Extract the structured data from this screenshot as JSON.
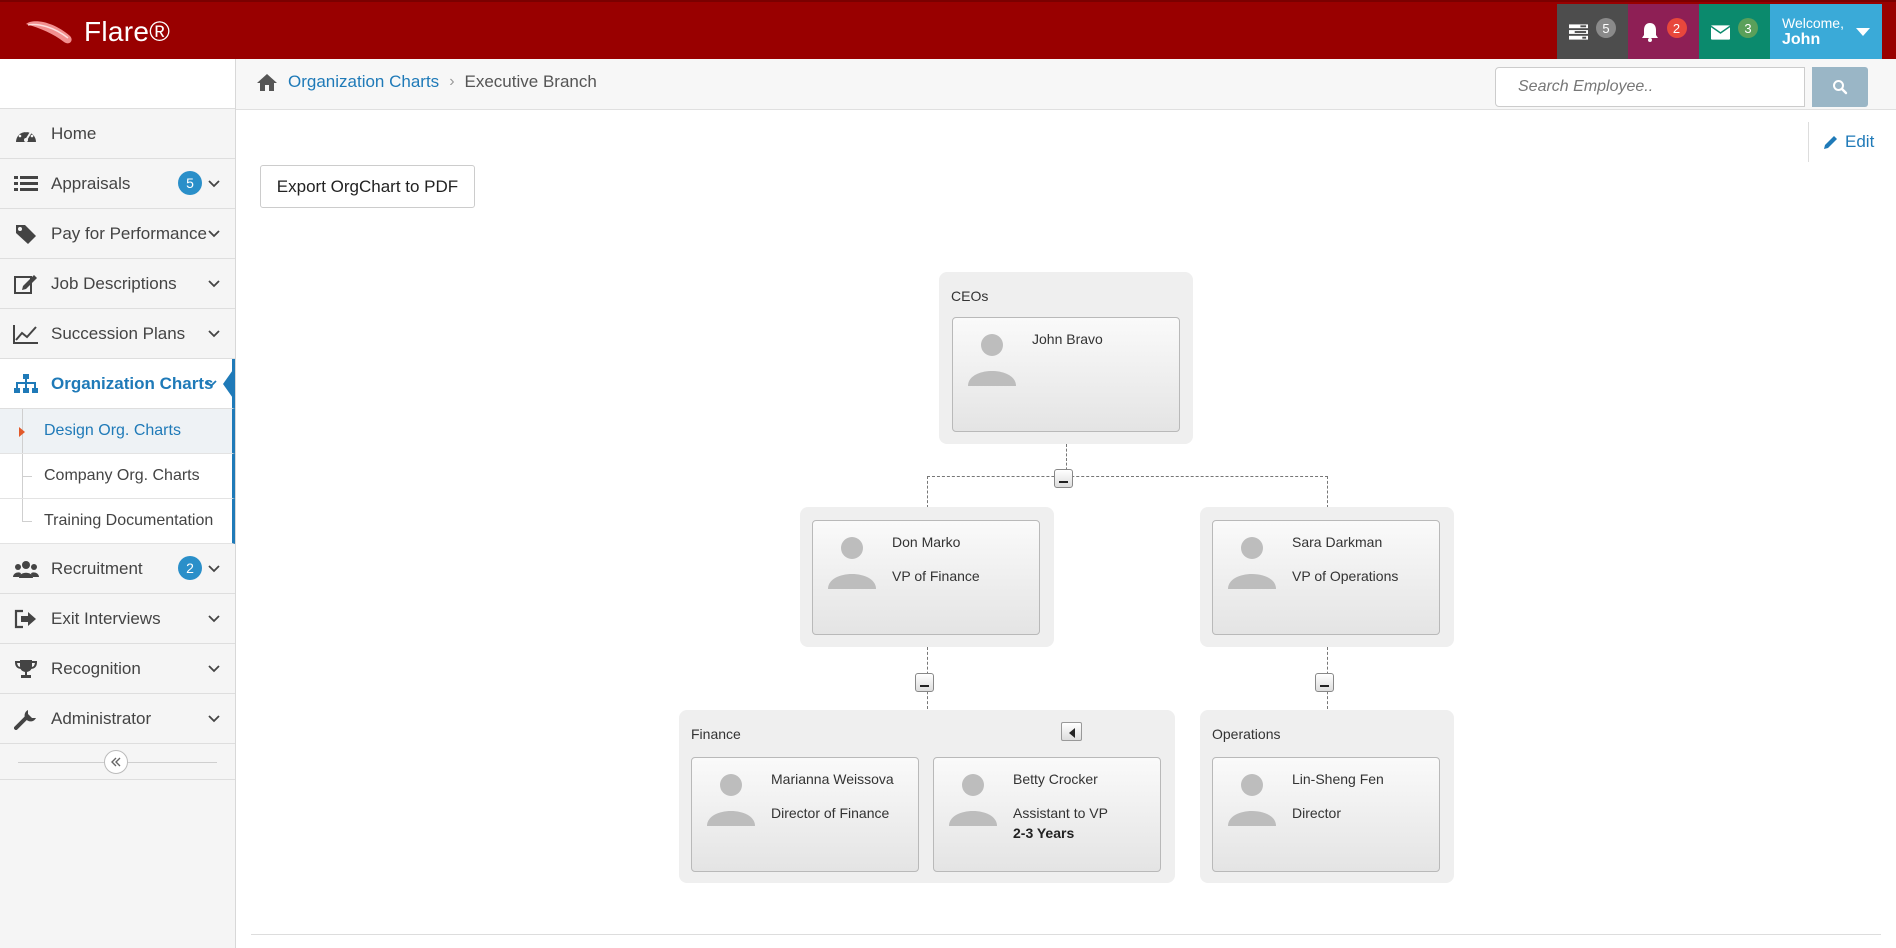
{
  "app": {
    "brand": "Flare®",
    "brand_color": "#990000"
  },
  "topbar": {
    "tasks": {
      "icon": "tasks-icon",
      "count": "5"
    },
    "alerts": {
      "icon": "bell-icon",
      "count": "2"
    },
    "mail": {
      "icon": "envelope-icon",
      "count": "3"
    },
    "user": {
      "welcome": "Welcome,",
      "name": "John"
    }
  },
  "sidebar": {
    "items": [
      {
        "label": "Home",
        "icon": "dashboard-icon"
      },
      {
        "label": "Appraisals",
        "icon": "list-icon",
        "badge": "5"
      },
      {
        "label": "Pay for Performance",
        "icon": "tag-icon"
      },
      {
        "label": "Job Descriptions",
        "icon": "edit-icon"
      },
      {
        "label": "Succession Plans",
        "icon": "line-chart-icon"
      },
      {
        "label": "Organization Charts",
        "icon": "sitemap-icon"
      },
      {
        "label": "Recruitment",
        "icon": "users-icon",
        "badge": "2"
      },
      {
        "label": "Exit Interviews",
        "icon": "sign-out-icon"
      },
      {
        "label": "Recognition",
        "icon": "trophy-icon"
      },
      {
        "label": "Administrator",
        "icon": "wrench-icon"
      }
    ],
    "subitems": [
      {
        "label": "Design Org. Charts"
      },
      {
        "label": "Company Org. Charts"
      },
      {
        "label": "Training Documentation"
      }
    ],
    "active_color": "#1f7ab8"
  },
  "breadcrumb": {
    "root": "Organization Charts",
    "current": "Executive Branch"
  },
  "search": {
    "placeholder": "Search Employee.."
  },
  "actions": {
    "edit": "Edit",
    "export": "Export OrgChart to PDF"
  },
  "orgchart": {
    "ceo_group": {
      "title": "CEOs",
      "members": [
        {
          "name": "John Bravo"
        }
      ]
    },
    "vp_left": {
      "name": "Don Marko",
      "title": "VP of Finance"
    },
    "vp_right": {
      "name": "Sara Darkman",
      "title": "VP of Operations"
    },
    "finance_group": {
      "title": "Finance",
      "members": [
        {
          "name": "Marianna Weissova",
          "title": "Director of Finance"
        },
        {
          "name": "Betty Crocker",
          "title": "Assistant to VP",
          "tenure": "2-3 Years"
        }
      ]
    },
    "operations_group": {
      "title": "Operations",
      "members": [
        {
          "name": "Lin-Sheng Fen",
          "title": "Director"
        }
      ]
    }
  }
}
